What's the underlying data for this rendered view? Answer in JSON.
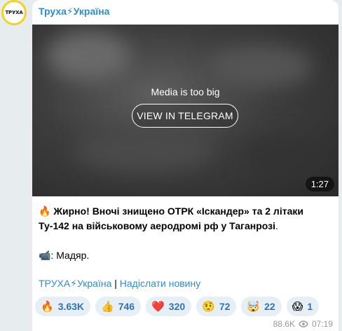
{
  "avatar": {
    "label": "ТРУХА"
  },
  "channel": {
    "name": "Труха⚡Україна"
  },
  "media": {
    "message": "Media is too big",
    "button_label": "VIEW IN TELEGRAM",
    "duration": "1:27"
  },
  "post": {
    "line1_emoji": "🔥",
    "line1_bold": "Жирно! Вночі знищено ОТРК «Іскандер» та 2 літаки Ту-142 на військовому аеродромі рф у Таганрозі",
    "line1_end": ".",
    "credit": "📹: Мадяр."
  },
  "links": {
    "channel_link": "ТРУХА⚡Україна",
    "separator": " | ",
    "submit_link": "Надіслати новину"
  },
  "reactions": [
    {
      "emoji": "🔥",
      "count": "3.63K"
    },
    {
      "emoji": "👍",
      "count": "746"
    },
    {
      "emoji": "❤️",
      "count": "320"
    },
    {
      "emoji": "🤨",
      "count": "72"
    },
    {
      "emoji": "🤯",
      "count": "22"
    },
    {
      "emoji": "😱",
      "count": "1"
    }
  ],
  "meta": {
    "views": "88.6K",
    "time": "07:19"
  },
  "colors": {
    "accent": "#2f8bcc",
    "reaction_bg": "#e6eef6",
    "avatar_ring": "#f5d21f"
  }
}
